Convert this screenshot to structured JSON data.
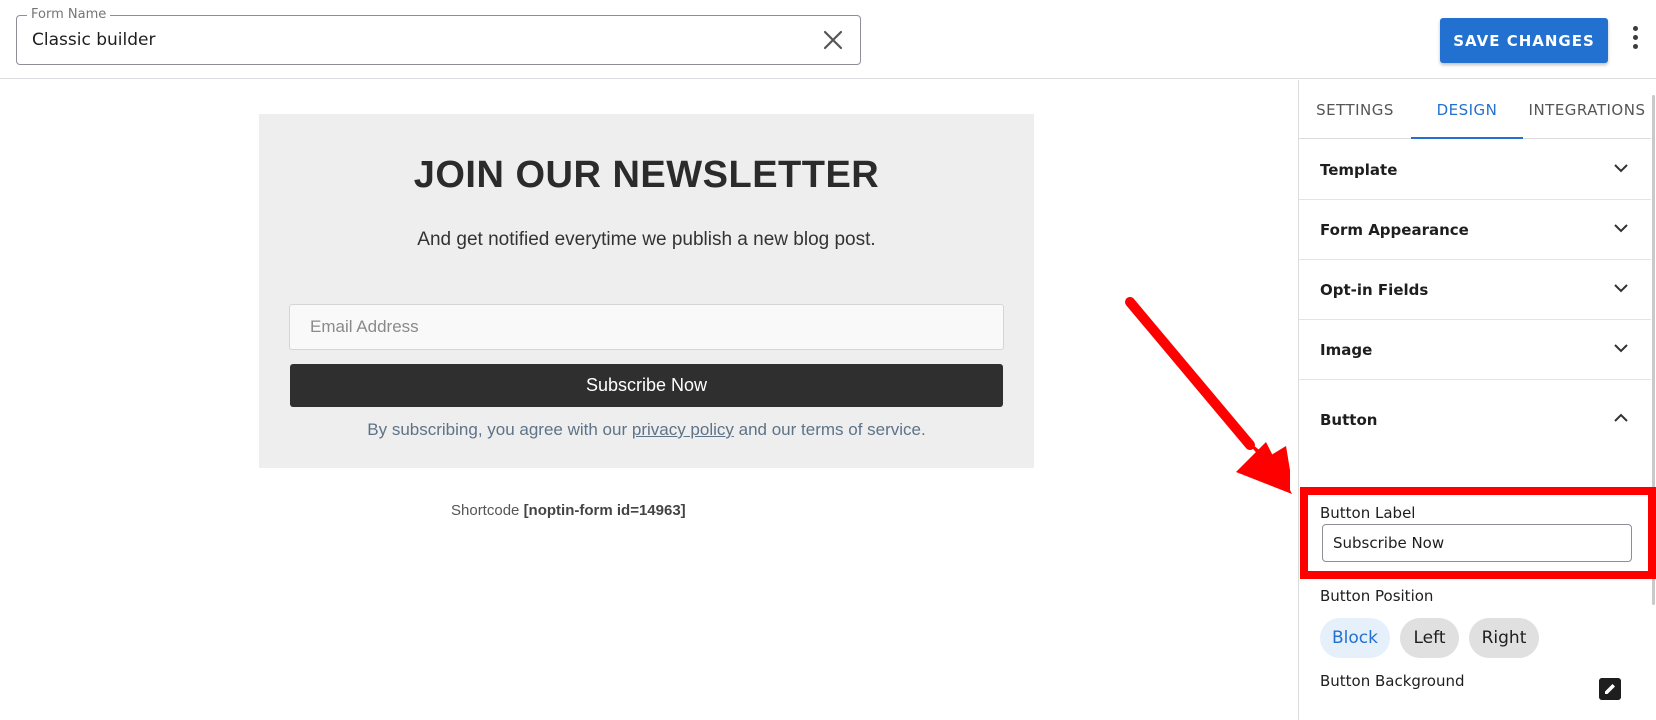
{
  "header": {
    "form_name_label": "Form Name",
    "form_name_value": "Classic builder",
    "save_label": "SAVE CHANGES"
  },
  "preview": {
    "title": "JOIN OUR NEWSLETTER",
    "subtitle": "And get notified everytime we publish a new blog post.",
    "email_placeholder": "Email Address",
    "subscribe_label": "Subscribe Now",
    "privacy_prefix": "By subscribing, you agree with our ",
    "privacy_link": "privacy policy",
    "privacy_suffix": " and our terms of service.",
    "shortcode_label": "Shortcode",
    "shortcode_value": "[noptin-form id=14963]"
  },
  "sidebar": {
    "tabs": [
      {
        "label": "SETTINGS",
        "active": false
      },
      {
        "label": "DESIGN",
        "active": true
      },
      {
        "label": "INTEGRATIONS",
        "active": false
      }
    ],
    "panels": [
      {
        "title": "Template",
        "expanded": false
      },
      {
        "title": "Form Appearance",
        "expanded": false
      },
      {
        "title": "Opt-in Fields",
        "expanded": false
      },
      {
        "title": "Image",
        "expanded": false
      },
      {
        "title": "Button",
        "expanded": true
      }
    ],
    "button_settings": {
      "label_field_label": "Button Label",
      "label_field_value": "Subscribe Now",
      "position_label": "Button Position",
      "position_options": [
        "Block",
        "Left",
        "Right"
      ],
      "position_selected": "Block",
      "background_label": "Button Background"
    }
  },
  "colors": {
    "accent": "#2271d1",
    "annotation": "#ff0000",
    "preview_bg": "#eeeeee",
    "subscribe_bg": "#2f2f2f"
  },
  "icons": [
    "close-icon",
    "more-vertical-icon",
    "chevron-down-icon",
    "chevron-up-icon",
    "pencil-icon"
  ]
}
